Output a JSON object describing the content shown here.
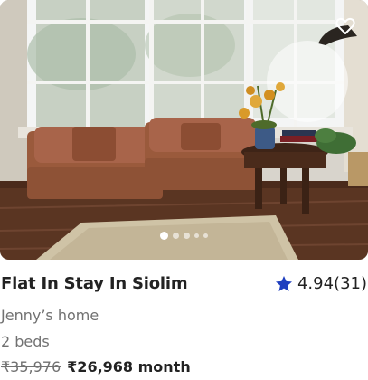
{
  "listing": {
    "title": "Flat In Stay In Siolim",
    "rating": "4.94(31)",
    "host": "Jenny’s home",
    "beds": "2 beds",
    "price_original": "₹35,976",
    "price_current": "₹26,968 month"
  },
  "gallery": {
    "slide_count": 5,
    "active_index": 0
  },
  "icons": {
    "favorite": "heart-icon",
    "rating": "star-icon"
  },
  "colors": {
    "star": "#1f3fbf",
    "text_primary": "#222222",
    "text_secondary": "#717171"
  }
}
